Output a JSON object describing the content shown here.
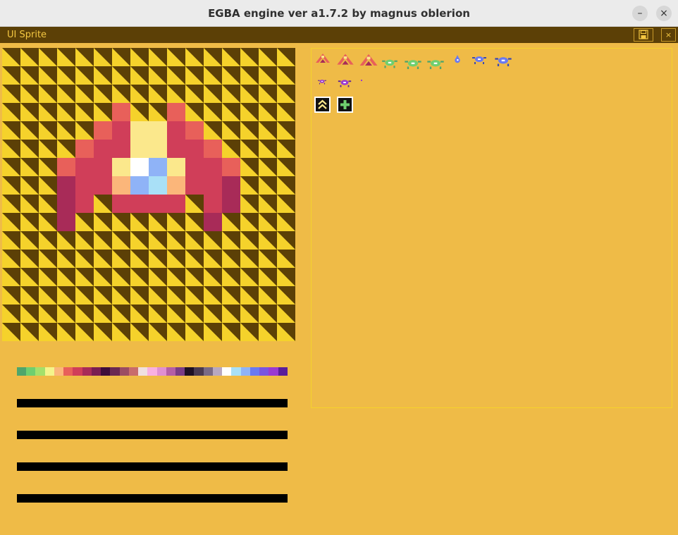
{
  "window": {
    "title": "EGBA engine ver a1.7.2 by magnus oblerion",
    "minimize_glyph": "–",
    "close_glyph": "×"
  },
  "panel": {
    "title": "UI Sprite",
    "save_icon": "floppy-disk-icon",
    "close_glyph": "×"
  },
  "colors": {
    "app_bg": "#efbb47",
    "header_bg": "#5c4006",
    "accent": "#f5c842",
    "checker_dark": "#5c4006",
    "checker_light": "#f5d22b"
  },
  "editor": {
    "grid_size": 16,
    "sprite_rows": [
      "................",
      "................",
      "................",
      "......a..a......",
      ".....abccba.....",
      "....abbccbba....",
      "...abbdefdbba...",
      "...gbbhijhbbg...",
      "...gb.bbbb.bg...",
      "...g.......g....",
      "................",
      "................",
      "................",
      "................",
      "................",
      "................"
    ],
    "sprite_colors": {
      "a": "#e8605a",
      "b": "#d03e59",
      "c": "#fbe88c",
      "d": "#fbe88c",
      "e": "#ffffff",
      "f": "#8fb3f7",
      "g": "#a82b58",
      "h": "#fbb67a",
      "i": "#8fb3f7",
      "j": "#a9e0f7"
    }
  },
  "palette": [
    "#4fa66b",
    "#6fcf6f",
    "#a4e06b",
    "#f4f48b",
    "#fbb67a",
    "#e8605a",
    "#d03e59",
    "#a82b58",
    "#7a1d52",
    "#3e0c3a",
    "#6a2852",
    "#9b4c63",
    "#c86c6c",
    "#f0e0e0",
    "#f9b0e0",
    "#e08fd2",
    "#b45ea6",
    "#7a3c85",
    "#1e1024",
    "#4a3a50",
    "#7a6a85",
    "#b8a8c0",
    "#ffffff",
    "#a9e0f7",
    "#8fb3f7",
    "#6a7af0",
    "#7a55e0",
    "#9a3ad0",
    "#5a1e9a"
  ],
  "sliders": [
    {
      "label": "",
      "value": 1
    },
    {
      "label": "",
      "value": 1
    },
    {
      "label": "",
      "value": 1
    },
    {
      "label": "",
      "value": 1
    }
  ],
  "sprites": [
    {
      "name": "ship-red-small",
      "kind": "ship",
      "color": "#e8605a",
      "dark": "#a82b58"
    },
    {
      "name": "ship-red-medium",
      "kind": "ship",
      "color": "#e8605a",
      "dark": "#a82b58"
    },
    {
      "name": "ship-red-large",
      "kind": "ship",
      "color": "#e8605a",
      "dark": "#a82b58"
    },
    {
      "name": "alien-green-1",
      "kind": "bug",
      "color": "#6fcf6f",
      "dark": "#4fa66b"
    },
    {
      "name": "alien-green-2",
      "kind": "bug",
      "color": "#6fcf6f",
      "dark": "#4fa66b"
    },
    {
      "name": "alien-green-3",
      "kind": "bug",
      "color": "#6fcf6f",
      "dark": "#4fa66b"
    },
    {
      "name": "drop-blue",
      "kind": "drop",
      "color": "#6a7af0",
      "dark": "#3e4ab0"
    },
    {
      "name": "alien-blue-1",
      "kind": "bug",
      "color": "#6a7af0",
      "dark": "#3e4ab0"
    },
    {
      "name": "alien-blue-2",
      "kind": "bug",
      "color": "#6a7af0",
      "dark": "#3e4ab0"
    },
    {
      "name": "alien-purple-small",
      "kind": "bug",
      "color": "#9a3ad0",
      "dark": "#5a1e9a"
    },
    {
      "name": "alien-purple-large",
      "kind": "bug",
      "color": "#9a3ad0",
      "dark": "#5a1e9a"
    },
    {
      "name": "dot-purple",
      "kind": "dot",
      "color": "#9a3ad0",
      "dark": "#5a1e9a"
    }
  ],
  "button_sprites": [
    {
      "name": "chevron-up-sprite-button",
      "icon": "double-chevron-up-icon",
      "color": "#fbe88c"
    },
    {
      "name": "plus-sprite-button",
      "icon": "plus-icon",
      "color": "#6fcf6f"
    }
  ]
}
